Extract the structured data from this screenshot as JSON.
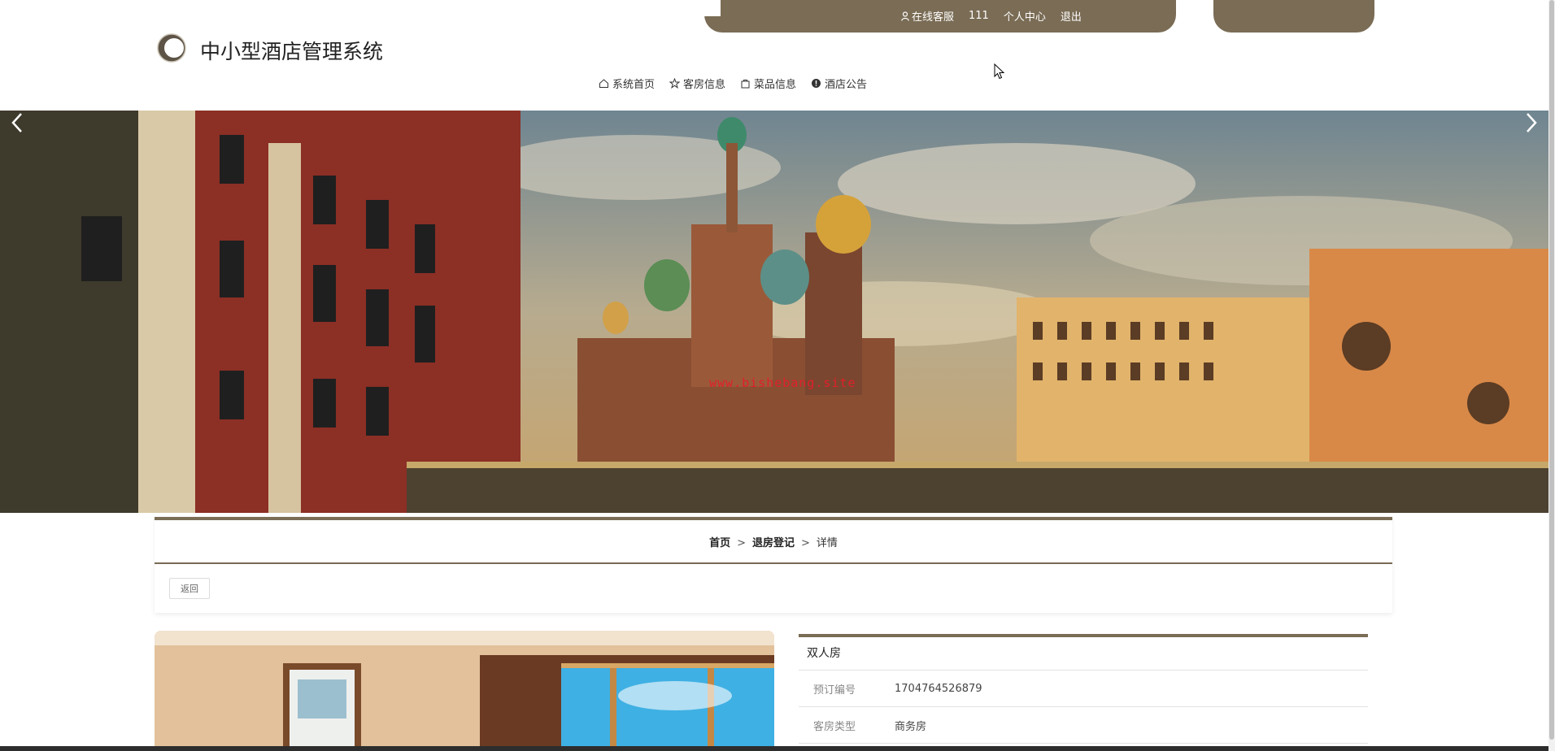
{
  "topbar": {
    "service": "在线客服",
    "username": "111",
    "profile": "个人中心",
    "logout": "退出"
  },
  "site": {
    "title": "中小型酒店管理系统"
  },
  "nav": [
    {
      "label": "系统首页",
      "icon": "home-icon"
    },
    {
      "label": "客房信息",
      "icon": "star-icon"
    },
    {
      "label": "菜品信息",
      "icon": "bag-icon"
    },
    {
      "label": "酒店公告",
      "icon": "info-icon"
    }
  ],
  "banner": {
    "watermark": "www.bishebang.site"
  },
  "breadcrumb": {
    "home": "首页",
    "section": "退房登记",
    "current": "详情",
    "sep": ">"
  },
  "back_label": "返回",
  "detail": {
    "title": "双人房",
    "rows": [
      {
        "label": "预订编号",
        "value": "1704764526879"
      },
      {
        "label": "客房类型",
        "value": "商务房"
      }
    ]
  },
  "colors": {
    "accent": "#7a6c55"
  }
}
